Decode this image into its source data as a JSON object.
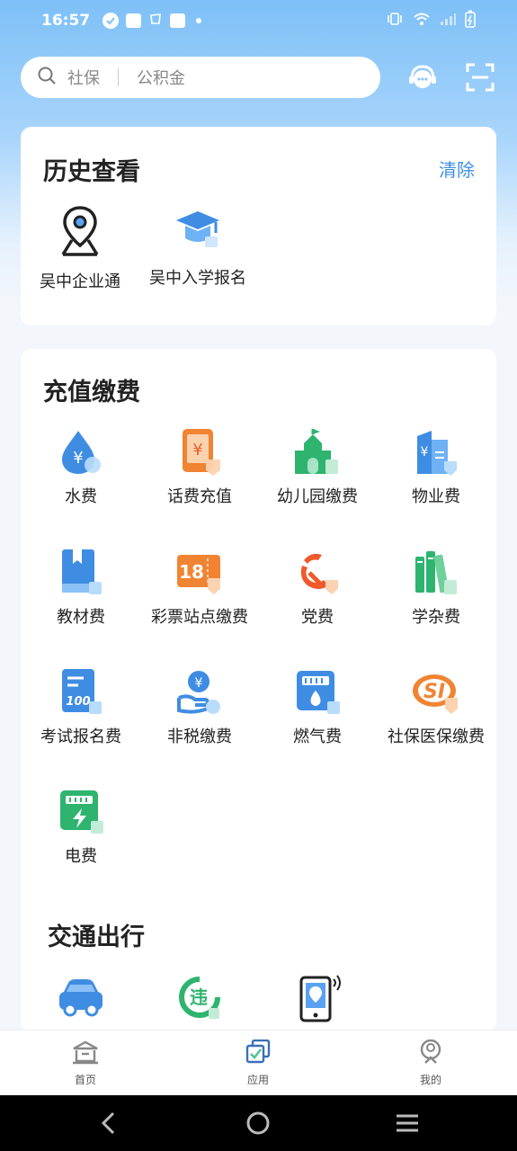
{
  "status_bar": {
    "time": "16:57"
  },
  "search": {
    "term1": "社保",
    "term2": "公积金"
  },
  "history": {
    "title": "历史查看",
    "clear_label": "清除",
    "items": [
      {
        "label": "吴中企业通",
        "icon": "map-pin-icon"
      },
      {
        "label": "吴中入学报名",
        "icon": "graduation-cap-icon"
      }
    ]
  },
  "payments": {
    "title": "充值缴费",
    "items": [
      {
        "label": "水费",
        "icon": "water-drop-icon"
      },
      {
        "label": "话费充值",
        "icon": "phone-recharge-icon"
      },
      {
        "label": "幼儿园缴费",
        "icon": "kindergarten-icon"
      },
      {
        "label": "物业费",
        "icon": "property-fee-icon"
      },
      {
        "label": "教材费",
        "icon": "textbook-icon"
      },
      {
        "label": "彩票站点缴费",
        "icon": "lottery-icon"
      },
      {
        "label": "党费",
        "icon": "party-fee-icon"
      },
      {
        "label": "学杂费",
        "icon": "books-icon"
      },
      {
        "label": "考试报名费",
        "icon": "exam-icon"
      },
      {
        "label": "非税缴费",
        "icon": "hand-coin-icon"
      },
      {
        "label": "燃气费",
        "icon": "gas-meter-icon"
      },
      {
        "label": "社保医保缴费",
        "icon": "social-security-icon"
      },
      {
        "label": "电费",
        "icon": "electricity-icon"
      }
    ]
  },
  "transport": {
    "title": "交通出行",
    "items": [
      {
        "icon": "car-icon"
      },
      {
        "icon": "violation-icon"
      },
      {
        "icon": "phone-location-icon"
      }
    ]
  },
  "bottom_nav": {
    "items": [
      {
        "label": "首页",
        "icon": "home-icon"
      },
      {
        "label": "应用",
        "icon": "apps-icon"
      },
      {
        "label": "我的",
        "icon": "profile-icon"
      }
    ]
  },
  "colors": {
    "accent": "#3d8fe0",
    "header_gradient_top": "#7dc0f7"
  }
}
